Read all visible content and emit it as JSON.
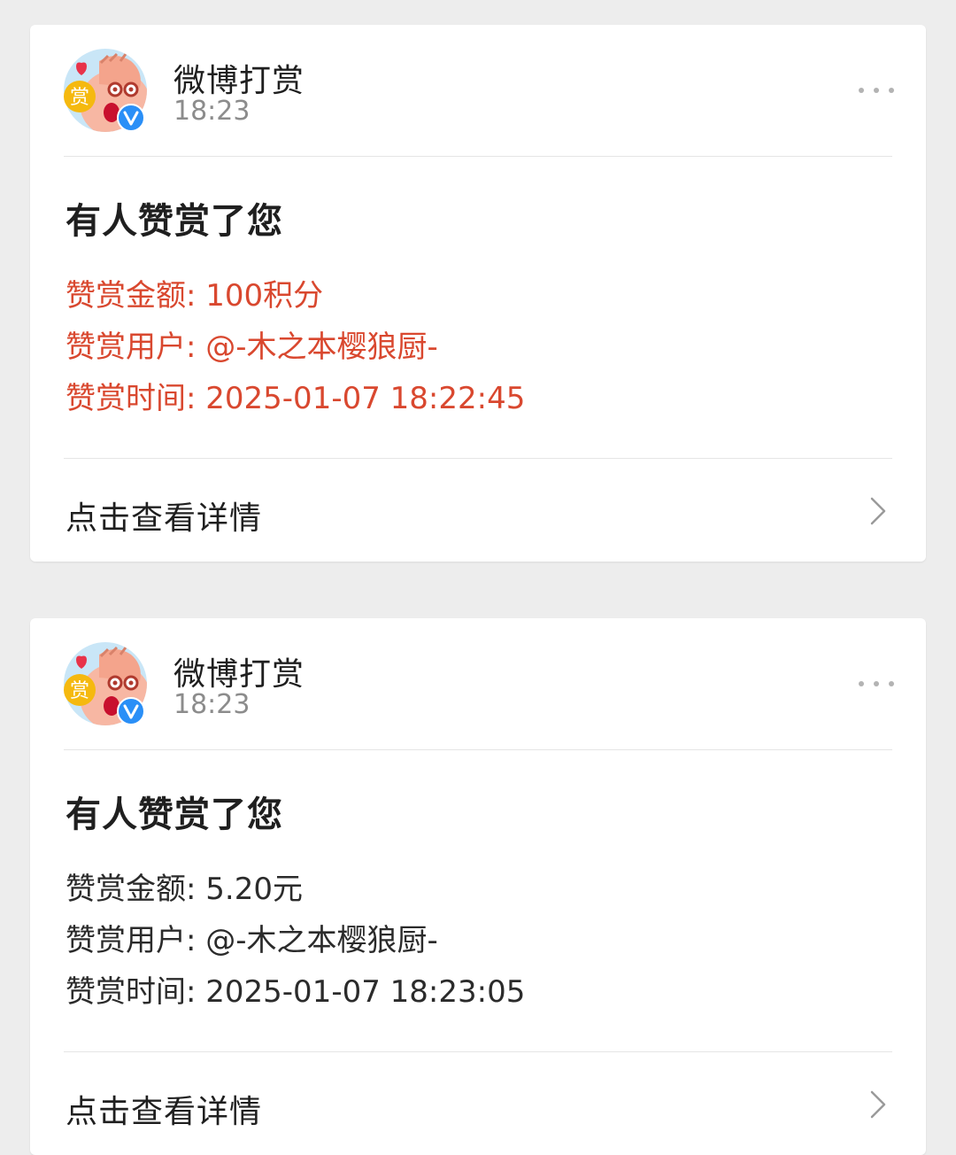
{
  "cards": [
    {
      "sender": "微博打赏",
      "time": "18:23",
      "title": "有人赞赏了您",
      "amount_line": "赞赏金额: 100积分",
      "user_line": "赞赏用户: @-木之本樱狼厨-",
      "time_line": "赞赏时间: 2025-01-07 18:22:45",
      "detail_label": "点击查看详情",
      "text_color": "#d9482f"
    },
    {
      "sender": "微博打赏",
      "time": "18:23",
      "title": "有人赞赏了您",
      "amount_line": "赞赏金额: 5.20元",
      "user_line": "赞赏用户: @-木之本樱狼厨-",
      "time_line": "赞赏时间: 2025-01-07 18:23:05",
      "detail_label": "点击查看详情",
      "text_color": "#2b2b2b"
    }
  ],
  "icons": {
    "more": "more-dots-icon",
    "chevron": "chevron-right-icon",
    "verified": "verified-badge-icon",
    "avatar_badge": "赏"
  }
}
